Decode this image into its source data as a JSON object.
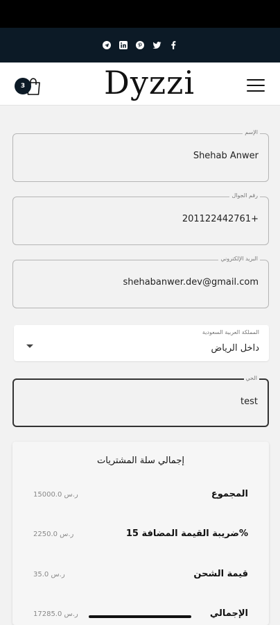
{
  "social": {
    "icons": [
      "telegram-icon",
      "linkedin-icon",
      "pinterest-icon",
      "twitter-icon",
      "facebook-icon"
    ]
  },
  "header": {
    "cart_count": "3",
    "logo": "Dyzzi"
  },
  "form": {
    "name": {
      "label": "الإسم",
      "value": "Shehab Anwer"
    },
    "phone": {
      "label": "رقم الجوال",
      "value": "201122442761+"
    },
    "email": {
      "label": "البريد الإلكتروني",
      "value": "shehabanwer.dev@gmail.com"
    },
    "region": {
      "label": "المملكة العربية السعودية",
      "value": "داخل الرياض"
    },
    "district": {
      "label": "الحي",
      "value": "test"
    }
  },
  "summary": {
    "title": "إجمالي سلة المشتريات",
    "rows": [
      {
        "label": "المجموع",
        "value": "15000.0 ر.س"
      },
      {
        "label": "ضريبة القيمة المضافة 15%",
        "value": "2250.0 ر.س"
      },
      {
        "label": "قيمة الشحن",
        "value": "35.0 ر.س"
      },
      {
        "label": "الإجمالي",
        "value": "17285.0 ر.س"
      }
    ]
  },
  "colors": {
    "navy": "#0c1a26",
    "background": "#f2f2f2"
  }
}
